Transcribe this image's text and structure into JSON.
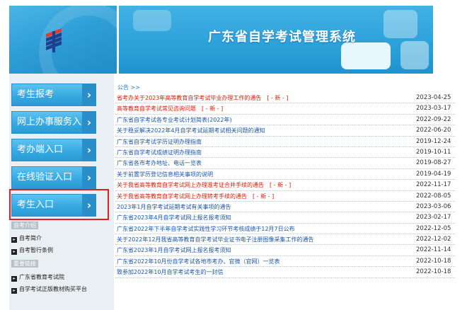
{
  "header": {
    "site_title": "广东省自学考试管理系统"
  },
  "colors": {
    "banner_blue": "#2da2da",
    "nav_blue": "#35a8e0",
    "highlight_red": "#e02020",
    "link_blue": "#1a56a8",
    "alert_red": "#d81e06"
  },
  "nav": {
    "items": [
      {
        "label": "考生报考"
      },
      {
        "label": "网上办事服务入口"
      },
      {
        "label": "考办端入口"
      },
      {
        "label": "在线验证入口"
      },
      {
        "label": "考生入口"
      }
    ]
  },
  "sidebar": {
    "section1_title": "自考介绍",
    "section1_links": [
      "自考简介",
      "自考暂行条例"
    ],
    "section2_title": "重要链接",
    "section2_links": [
      "广东省教育考试院",
      "自学考试正版教材购买平台"
    ]
  },
  "notices": {
    "header": "公告 >>",
    "new_tag": "[ - 新 - ]",
    "items": [
      {
        "title": "省考办关于2023年高等教育自学考试毕业办理工作的通告",
        "date": "2023-04-25",
        "red": true,
        "new": true
      },
      {
        "title": "高等教育自学考试常见咨询问题",
        "date": "2023-03-17",
        "red": true,
        "new": true
      },
      {
        "title": "广东省自学考试各专业考试计划简表(2022年)",
        "date": "2022-09-22",
        "red": false,
        "new": false
      },
      {
        "title": "关于稳妥解决2022年4月自学考试延期考试相关问题的通知",
        "date": "2022-06-20",
        "red": false,
        "new": false
      },
      {
        "title": "广东省自学考试学历证明办理指南",
        "date": "2019-12-24",
        "red": false,
        "new": false
      },
      {
        "title": "广东省自学考试成绩证明办理指南",
        "date": "2019-10-11",
        "red": false,
        "new": false
      },
      {
        "title": "广东省各市考办地址、电话一览表",
        "date": "2019-08-27",
        "red": false,
        "new": false
      },
      {
        "title": "关于前置学历登记信息相关事项的说明",
        "date": "2019-04-19",
        "red": false,
        "new": false
      },
      {
        "title": "关于我省高等教育自学考试网上办理准考证合并手续的通告",
        "date": "2022-11-17",
        "red": true,
        "new": true
      },
      {
        "title": "关于我省高等教育自学考试网上办理转考手续的通告",
        "date": "2022-08-05",
        "red": true,
        "new": true
      },
      {
        "title": "2023年1月自学考试延期考试有关事项的通告",
        "date": "2023-03-06",
        "red": false,
        "new": false
      },
      {
        "title": "广东省2023年4月自学考试网上报名报考须知",
        "date": "2023-02-17",
        "red": false,
        "new": false
      },
      {
        "title": "广东省2022年下半年自学考试实践性学习环节考核成绩于12月7日公布",
        "date": "2022-12-05",
        "red": false,
        "new": false
      },
      {
        "title": "关于2022年12月我省高等教育自学考试毕业证书电子注册图像采集工作的通告",
        "date": "2022-12-02",
        "red": false,
        "new": false
      },
      {
        "title": "广东省2023年1月自学考试网上报名报考须知",
        "date": "2022-11-14",
        "red": false,
        "new": false
      },
      {
        "title": "广东省2022年10月份自学考试各地市考办、官微（官网）一览表",
        "date": "2022-10-18",
        "red": false,
        "new": false
      },
      {
        "title": "致参加2022年10月自学考试考生的一封信",
        "date": "2022-10-18",
        "red": false,
        "new": false
      }
    ]
  }
}
